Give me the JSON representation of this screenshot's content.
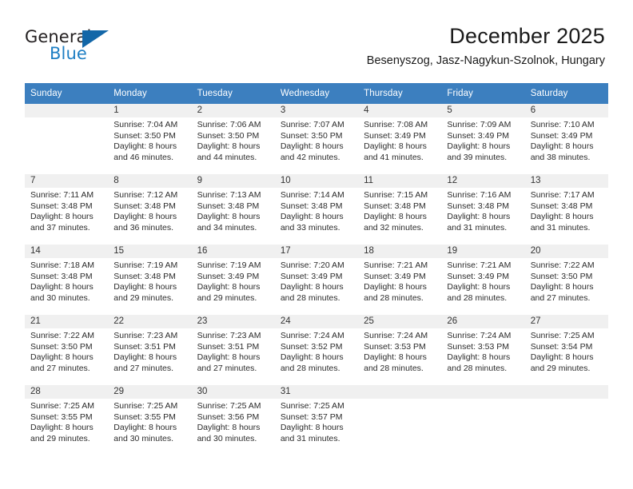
{
  "brand": {
    "name_top": "General",
    "name_bottom": "Blue",
    "triangle_color": "#1367a8",
    "blue_text_color": "#1f7fc4"
  },
  "header": {
    "title": "December 2025",
    "location": "Besenyszog, Jasz-Nagykun-Szolnok, Hungary"
  },
  "theme": {
    "header_row_bg": "#3c7fbf",
    "header_row_text": "#ffffff",
    "daynum_band_bg": "#f0f0f0",
    "grid_line": "#3c7fbf",
    "page_bg": "#ffffff"
  },
  "weekdays": [
    "Sunday",
    "Monday",
    "Tuesday",
    "Wednesday",
    "Thursday",
    "Friday",
    "Saturday"
  ],
  "weeks": [
    [
      {
        "day": "",
        "sunrise": "",
        "sunset": "",
        "daylight_line1": "",
        "daylight_line2": ""
      },
      {
        "day": "1",
        "sunrise": "Sunrise: 7:04 AM",
        "sunset": "Sunset: 3:50 PM",
        "daylight_line1": "Daylight: 8 hours",
        "daylight_line2": "and 46 minutes."
      },
      {
        "day": "2",
        "sunrise": "Sunrise: 7:06 AM",
        "sunset": "Sunset: 3:50 PM",
        "daylight_line1": "Daylight: 8 hours",
        "daylight_line2": "and 44 minutes."
      },
      {
        "day": "3",
        "sunrise": "Sunrise: 7:07 AM",
        "sunset": "Sunset: 3:50 PM",
        "daylight_line1": "Daylight: 8 hours",
        "daylight_line2": "and 42 minutes."
      },
      {
        "day": "4",
        "sunrise": "Sunrise: 7:08 AM",
        "sunset": "Sunset: 3:49 PM",
        "daylight_line1": "Daylight: 8 hours",
        "daylight_line2": "and 41 minutes."
      },
      {
        "day": "5",
        "sunrise": "Sunrise: 7:09 AM",
        "sunset": "Sunset: 3:49 PM",
        "daylight_line1": "Daylight: 8 hours",
        "daylight_line2": "and 39 minutes."
      },
      {
        "day": "6",
        "sunrise": "Sunrise: 7:10 AM",
        "sunset": "Sunset: 3:49 PM",
        "daylight_line1": "Daylight: 8 hours",
        "daylight_line2": "and 38 minutes."
      }
    ],
    [
      {
        "day": "7",
        "sunrise": "Sunrise: 7:11 AM",
        "sunset": "Sunset: 3:48 PM",
        "daylight_line1": "Daylight: 8 hours",
        "daylight_line2": "and 37 minutes."
      },
      {
        "day": "8",
        "sunrise": "Sunrise: 7:12 AM",
        "sunset": "Sunset: 3:48 PM",
        "daylight_line1": "Daylight: 8 hours",
        "daylight_line2": "and 36 minutes."
      },
      {
        "day": "9",
        "sunrise": "Sunrise: 7:13 AM",
        "sunset": "Sunset: 3:48 PM",
        "daylight_line1": "Daylight: 8 hours",
        "daylight_line2": "and 34 minutes."
      },
      {
        "day": "10",
        "sunrise": "Sunrise: 7:14 AM",
        "sunset": "Sunset: 3:48 PM",
        "daylight_line1": "Daylight: 8 hours",
        "daylight_line2": "and 33 minutes."
      },
      {
        "day": "11",
        "sunrise": "Sunrise: 7:15 AM",
        "sunset": "Sunset: 3:48 PM",
        "daylight_line1": "Daylight: 8 hours",
        "daylight_line2": "and 32 minutes."
      },
      {
        "day": "12",
        "sunrise": "Sunrise: 7:16 AM",
        "sunset": "Sunset: 3:48 PM",
        "daylight_line1": "Daylight: 8 hours",
        "daylight_line2": "and 31 minutes."
      },
      {
        "day": "13",
        "sunrise": "Sunrise: 7:17 AM",
        "sunset": "Sunset: 3:48 PM",
        "daylight_line1": "Daylight: 8 hours",
        "daylight_line2": "and 31 minutes."
      }
    ],
    [
      {
        "day": "14",
        "sunrise": "Sunrise: 7:18 AM",
        "sunset": "Sunset: 3:48 PM",
        "daylight_line1": "Daylight: 8 hours",
        "daylight_line2": "and 30 minutes."
      },
      {
        "day": "15",
        "sunrise": "Sunrise: 7:19 AM",
        "sunset": "Sunset: 3:48 PM",
        "daylight_line1": "Daylight: 8 hours",
        "daylight_line2": "and 29 minutes."
      },
      {
        "day": "16",
        "sunrise": "Sunrise: 7:19 AM",
        "sunset": "Sunset: 3:49 PM",
        "daylight_line1": "Daylight: 8 hours",
        "daylight_line2": "and 29 minutes."
      },
      {
        "day": "17",
        "sunrise": "Sunrise: 7:20 AM",
        "sunset": "Sunset: 3:49 PM",
        "daylight_line1": "Daylight: 8 hours",
        "daylight_line2": "and 28 minutes."
      },
      {
        "day": "18",
        "sunrise": "Sunrise: 7:21 AM",
        "sunset": "Sunset: 3:49 PM",
        "daylight_line1": "Daylight: 8 hours",
        "daylight_line2": "and 28 minutes."
      },
      {
        "day": "19",
        "sunrise": "Sunrise: 7:21 AM",
        "sunset": "Sunset: 3:49 PM",
        "daylight_line1": "Daylight: 8 hours",
        "daylight_line2": "and 28 minutes."
      },
      {
        "day": "20",
        "sunrise": "Sunrise: 7:22 AM",
        "sunset": "Sunset: 3:50 PM",
        "daylight_line1": "Daylight: 8 hours",
        "daylight_line2": "and 27 minutes."
      }
    ],
    [
      {
        "day": "21",
        "sunrise": "Sunrise: 7:22 AM",
        "sunset": "Sunset: 3:50 PM",
        "daylight_line1": "Daylight: 8 hours",
        "daylight_line2": "and 27 minutes."
      },
      {
        "day": "22",
        "sunrise": "Sunrise: 7:23 AM",
        "sunset": "Sunset: 3:51 PM",
        "daylight_line1": "Daylight: 8 hours",
        "daylight_line2": "and 27 minutes."
      },
      {
        "day": "23",
        "sunrise": "Sunrise: 7:23 AM",
        "sunset": "Sunset: 3:51 PM",
        "daylight_line1": "Daylight: 8 hours",
        "daylight_line2": "and 27 minutes."
      },
      {
        "day": "24",
        "sunrise": "Sunrise: 7:24 AM",
        "sunset": "Sunset: 3:52 PM",
        "daylight_line1": "Daylight: 8 hours",
        "daylight_line2": "and 28 minutes."
      },
      {
        "day": "25",
        "sunrise": "Sunrise: 7:24 AM",
        "sunset": "Sunset: 3:53 PM",
        "daylight_line1": "Daylight: 8 hours",
        "daylight_line2": "and 28 minutes."
      },
      {
        "day": "26",
        "sunrise": "Sunrise: 7:24 AM",
        "sunset": "Sunset: 3:53 PM",
        "daylight_line1": "Daylight: 8 hours",
        "daylight_line2": "and 28 minutes."
      },
      {
        "day": "27",
        "sunrise": "Sunrise: 7:25 AM",
        "sunset": "Sunset: 3:54 PM",
        "daylight_line1": "Daylight: 8 hours",
        "daylight_line2": "and 29 minutes."
      }
    ],
    [
      {
        "day": "28",
        "sunrise": "Sunrise: 7:25 AM",
        "sunset": "Sunset: 3:55 PM",
        "daylight_line1": "Daylight: 8 hours",
        "daylight_line2": "and 29 minutes."
      },
      {
        "day": "29",
        "sunrise": "Sunrise: 7:25 AM",
        "sunset": "Sunset: 3:55 PM",
        "daylight_line1": "Daylight: 8 hours",
        "daylight_line2": "and 30 minutes."
      },
      {
        "day": "30",
        "sunrise": "Sunrise: 7:25 AM",
        "sunset": "Sunset: 3:56 PM",
        "daylight_line1": "Daylight: 8 hours",
        "daylight_line2": "and 30 minutes."
      },
      {
        "day": "31",
        "sunrise": "Sunrise: 7:25 AM",
        "sunset": "Sunset: 3:57 PM",
        "daylight_line1": "Daylight: 8 hours",
        "daylight_line2": "and 31 minutes."
      },
      {
        "day": "",
        "sunrise": "",
        "sunset": "",
        "daylight_line1": "",
        "daylight_line2": ""
      },
      {
        "day": "",
        "sunrise": "",
        "sunset": "",
        "daylight_line1": "",
        "daylight_line2": ""
      },
      {
        "day": "",
        "sunrise": "",
        "sunset": "",
        "daylight_line1": "",
        "daylight_line2": ""
      }
    ]
  ]
}
